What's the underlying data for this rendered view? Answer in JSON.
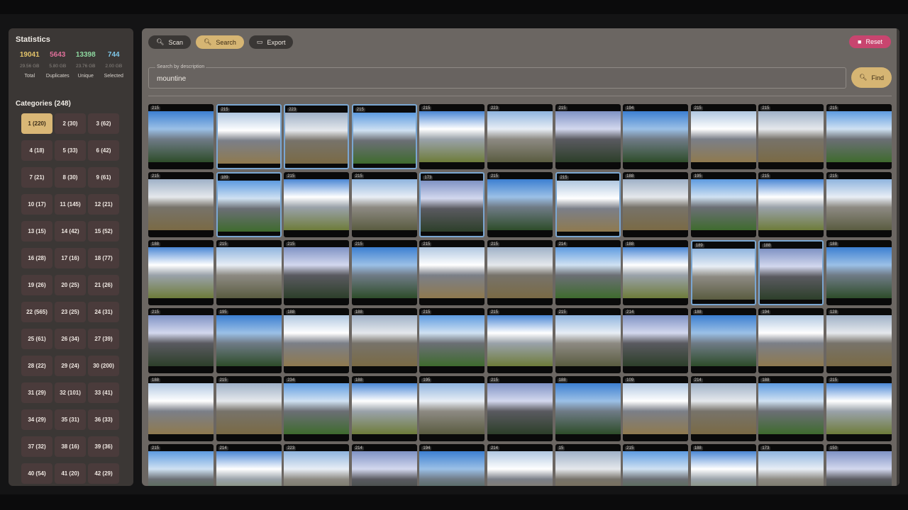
{
  "statistics": {
    "title": "Statistics",
    "items": [
      {
        "value": "19041",
        "size": "29.56 GB",
        "label": "Total",
        "color": "#e4c46a"
      },
      {
        "value": "5643",
        "size": "5.80 GB",
        "label": "Duplicates",
        "color": "#e0709a"
      },
      {
        "value": "13398",
        "size": "23.76 GB",
        "label": "Unique",
        "color": "#8ed8a0"
      },
      {
        "value": "744",
        "size": "2.00 GB",
        "label": "Selected",
        "color": "#7ec7e8"
      }
    ]
  },
  "categories": {
    "title": "Categories (248)",
    "items": [
      "1 (220)",
      "2 (30)",
      "3 (62)",
      "4 (18)",
      "5 (33)",
      "6 (42)",
      "7 (21)",
      "8 (30)",
      "9 (61)",
      "10 (17)",
      "11 (145)",
      "12 (21)",
      "13 (15)",
      "14 (42)",
      "15 (52)",
      "16 (28)",
      "17 (16)",
      "18 (77)",
      "19 (26)",
      "20 (25)",
      "21 (26)",
      "22 (565)",
      "23 (25)",
      "24 (31)",
      "25 (61)",
      "26 (34)",
      "27 (39)",
      "28 (22)",
      "29 (24)",
      "30 (200)",
      "31 (29)",
      "32 (101)",
      "33 (41)",
      "34 (29)",
      "35 (31)",
      "36 (33)",
      "37 (32)",
      "38 (16)",
      "39 (36)",
      "40 (54)",
      "41 (20)",
      "42 (29)"
    ],
    "active_index": 0
  },
  "toolbar": {
    "scan_label": "Scan",
    "search_label": "Search",
    "export_label": "Export",
    "reset_label": "Reset"
  },
  "search": {
    "label": "Search by description",
    "value": "mountine",
    "find_label": "Find"
  },
  "thumbnails": [
    {
      "badge": "215",
      "sel": false
    },
    {
      "badge": "215",
      "sel": true
    },
    {
      "badge": "223",
      "sel": true
    },
    {
      "badge": "215",
      "sel": true
    },
    {
      "badge": "215",
      "sel": false
    },
    {
      "badge": "223",
      "sel": false
    },
    {
      "badge": "215",
      "sel": false
    },
    {
      "badge": "194",
      "sel": false
    },
    {
      "badge": "215",
      "sel": false
    },
    {
      "badge": "215",
      "sel": false
    },
    {
      "badge": "215",
      "sel": false
    },
    {
      "badge": "215",
      "sel": false
    },
    {
      "badge": "189",
      "sel": true
    },
    {
      "badge": "215",
      "sel": false
    },
    {
      "badge": "215",
      "sel": false
    },
    {
      "badge": "173",
      "sel": true
    },
    {
      "badge": "215",
      "sel": false
    },
    {
      "badge": "215",
      "sel": true
    },
    {
      "badge": "188",
      "sel": false
    },
    {
      "badge": "195",
      "sel": false
    },
    {
      "badge": "215",
      "sel": false
    },
    {
      "badge": "215",
      "sel": false
    },
    {
      "badge": "188",
      "sel": false
    },
    {
      "badge": "215",
      "sel": false
    },
    {
      "badge": "215",
      "sel": false
    },
    {
      "badge": "215",
      "sel": false
    },
    {
      "badge": "215",
      "sel": false
    },
    {
      "badge": "215",
      "sel": false
    },
    {
      "badge": "214",
      "sel": false
    },
    {
      "badge": "188",
      "sel": false
    },
    {
      "badge": "189",
      "sel": true
    },
    {
      "badge": "188",
      "sel": true
    },
    {
      "badge": "188",
      "sel": false
    },
    {
      "badge": "215",
      "sel": false
    },
    {
      "badge": "195",
      "sel": false
    },
    {
      "badge": "188",
      "sel": false
    },
    {
      "badge": "188",
      "sel": false
    },
    {
      "badge": "215",
      "sel": false
    },
    {
      "badge": "215",
      "sel": false
    },
    {
      "badge": "215",
      "sel": false
    },
    {
      "badge": "214",
      "sel": false
    },
    {
      "badge": "188",
      "sel": false
    },
    {
      "badge": "194",
      "sel": false
    },
    {
      "badge": "128",
      "sel": false
    },
    {
      "badge": "188",
      "sel": false
    },
    {
      "badge": "215",
      "sel": false
    },
    {
      "badge": "234",
      "sel": false
    },
    {
      "badge": "188",
      "sel": false
    },
    {
      "badge": "195",
      "sel": false
    },
    {
      "badge": "215",
      "sel": false
    },
    {
      "badge": "188",
      "sel": false
    },
    {
      "badge": "109",
      "sel": false
    },
    {
      "badge": "214",
      "sel": false
    },
    {
      "badge": "188",
      "sel": false
    },
    {
      "badge": "215",
      "sel": false
    },
    {
      "badge": "215",
      "sel": false
    },
    {
      "badge": "214",
      "sel": false
    },
    {
      "badge": "223",
      "sel": false
    },
    {
      "badge": "214",
      "sel": false
    },
    {
      "badge": "194",
      "sel": false
    },
    {
      "badge": "214",
      "sel": false
    },
    {
      "badge": "15",
      "sel": false
    },
    {
      "badge": "215",
      "sel": false
    },
    {
      "badge": "188",
      "sel": false
    },
    {
      "badge": "173",
      "sel": false
    },
    {
      "badge": "150",
      "sel": false
    }
  ],
  "colors": {
    "accent": "#d6b573",
    "selected_border": "#7aa6d1",
    "reset": "#c8456f"
  }
}
